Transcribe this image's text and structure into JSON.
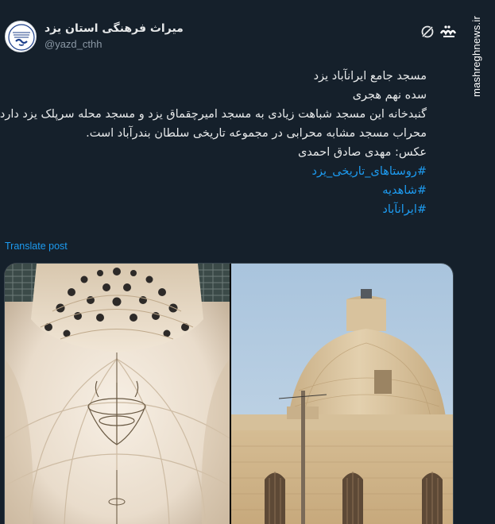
{
  "account": {
    "display_name": "میراث فرهنگی استان یزد",
    "handle": "@yazd_cthh",
    "avatar_icon": "yazd-heritage-seal-icon"
  },
  "post": {
    "lines": [
      "مسجد جامع ایرانآباد یزد",
      "سده نهم هجری",
      "گنبدخانه این مسجد شباهت زیادی به مسجد امیرچقماق یزد و مسجد محله سرپلک یزد دارد.",
      "محراب مسجد مشابه محرابی در مجموعه تاریخی سلطان بندرآباد است.",
      "عکس: مهدی صادق احمدی"
    ],
    "hashtags": [
      "#روستاهای_تاریخی_یزد",
      "#شاهدیه",
      "#ایرانآباد"
    ],
    "translate_label": "Translate post"
  },
  "media": {
    "left_photo": "dome-interior-photo",
    "right_photo": "dome-exterior-photo"
  },
  "watermark": {
    "text": "mashreghnews.ir",
    "logo_icon": "mashregh-logo-icon"
  },
  "colors": {
    "background": "#15202b",
    "link": "#1d9bf0",
    "text": "#e7e9ea",
    "secondary": "#8b98a5"
  }
}
